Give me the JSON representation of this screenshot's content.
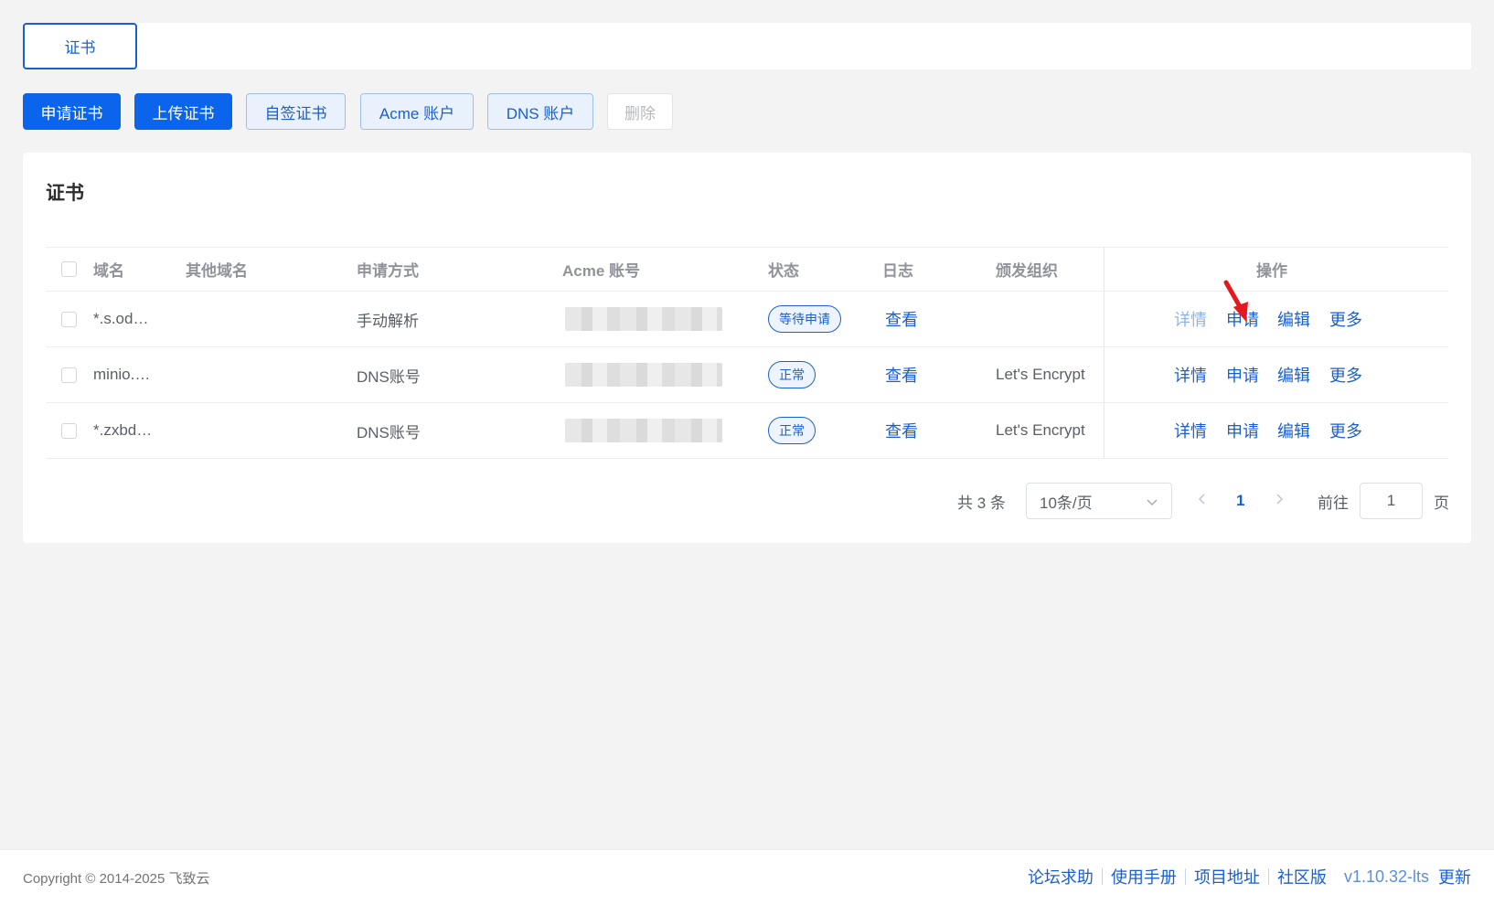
{
  "tabs": [
    {
      "label": "证书",
      "active": true
    }
  ],
  "toolbar": {
    "apply_cert": "申请证书",
    "upload_cert": "上传证书",
    "self_signed": "自签证书",
    "acme_account": "Acme 账户",
    "dns_account": "DNS 账户",
    "delete": "删除"
  },
  "card": {
    "title": "证书"
  },
  "table": {
    "headers": {
      "domain": "域名",
      "other_domains": "其他域名",
      "apply_method": "申请方式",
      "acme_account": "Acme 账号",
      "status": "状态",
      "log": "日志",
      "issuer": "颁发组织",
      "actions": "操作"
    },
    "rows": [
      {
        "domain": "*.s.od…",
        "other_domains": "",
        "apply_method": "手动解析",
        "status": "等待申请",
        "log": "查看",
        "issuer": "",
        "detail": "详情",
        "apply": "申请",
        "edit": "编辑",
        "more": "更多"
      },
      {
        "domain": "minio.…",
        "other_domains": "",
        "apply_method": "DNS账号",
        "status": "正常",
        "log": "查看",
        "issuer": "Let's Encrypt",
        "detail": "详情",
        "apply": "申请",
        "edit": "编辑",
        "more": "更多"
      },
      {
        "domain": "*.zxbd…",
        "other_domains": "",
        "apply_method": "DNS账号",
        "status": "正常",
        "log": "查看",
        "issuer": "Let's Encrypt",
        "detail": "详情",
        "apply": "申请",
        "edit": "编辑",
        "more": "更多"
      }
    ]
  },
  "pagination": {
    "total": "共 3 条",
    "page_size": "10条/页",
    "current_page": "1",
    "goto_label": "前往",
    "goto_value": "1",
    "page_suffix": "页"
  },
  "footer": {
    "copyright": "Copyright © 2014-2025 飞致云",
    "links": [
      "论坛求助",
      "使用手册",
      "项目地址",
      "社区版"
    ],
    "version": "v1.10.32-lts",
    "update": "更新"
  },
  "colors": {
    "accent": "#0a64ec",
    "link": "#1a5fd0",
    "background": "#f3f3f3",
    "annotation_arrow": "#e6181e"
  },
  "icons": [
    "chevron-down-icon",
    "chevron-left-icon",
    "chevron-right-icon",
    "red-arrow-annotation"
  ]
}
